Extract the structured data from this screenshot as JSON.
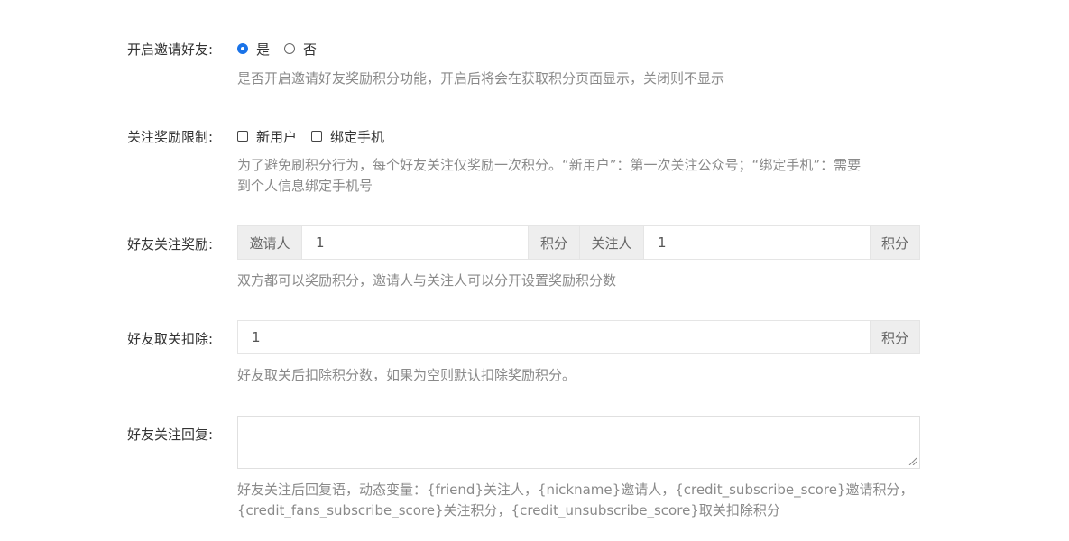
{
  "invite": {
    "label": "开启邀请好友:",
    "options": [
      {
        "label": "是",
        "selected": true
      },
      {
        "label": "否",
        "selected": false
      }
    ],
    "help": "是否开启邀请好友奖励积分功能，开启后将会在获取积分页面显示，关闭则不显示"
  },
  "limit": {
    "label": "关注奖励限制:",
    "options": [
      {
        "label": "新用户",
        "checked": false
      },
      {
        "label": "绑定手机",
        "checked": false
      }
    ],
    "help_line1": "为了避免刷积分行为，每个好友关注仅奖励一次积分。“新用户”：第一次关注公众号；“绑定手机”：需要",
    "help_line2": "到个人信息绑定手机号"
  },
  "reward": {
    "label": "好友关注奖励:",
    "inviter_label": "邀请人",
    "inviter_value": "1",
    "inviter_unit": "积分",
    "follower_label": "关注人",
    "follower_value": "1",
    "follower_unit": "积分",
    "help": "双方都可以奖励积分，邀请人与关注人可以分开设置奖励积分数"
  },
  "deduct": {
    "label": "好友取关扣除:",
    "value": "1",
    "unit": "积分",
    "help": "好友取关后扣除积分数，如果为空则默认扣除奖励积分。"
  },
  "reply": {
    "label": "好友关注回复:",
    "value": "",
    "help_line1": "好友关注后回复语，动态变量：{friend}关注人，{nickname}邀请人，{credit_subscribe_score}邀请积分，",
    "help_line2": "{credit_fans_subscribe_score}关注积分，{credit_unsubscribe_score}取关扣除积分"
  }
}
